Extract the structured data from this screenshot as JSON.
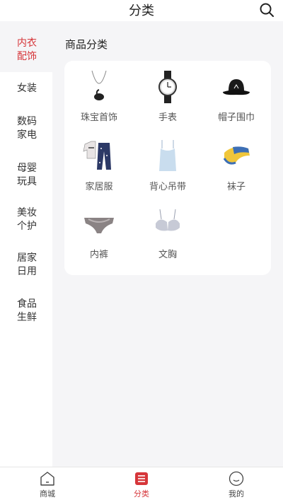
{
  "header": {
    "title": "分类",
    "search_icon": "search-icon"
  },
  "sidebar": {
    "items": [
      {
        "label": "内衣配饰",
        "active": true
      },
      {
        "label": "女装"
      },
      {
        "label": "数码家电"
      },
      {
        "label": "母婴玩具"
      },
      {
        "label": "美妆个护"
      },
      {
        "label": "居家日用"
      },
      {
        "label": "食品生鲜"
      }
    ]
  },
  "main": {
    "section_title": "商品分类",
    "categories": [
      {
        "label": "珠宝首饰",
        "icon": "necklace-icon"
      },
      {
        "label": "手表",
        "icon": "watch-icon"
      },
      {
        "label": "帽子围巾",
        "icon": "hat-icon"
      },
      {
        "label": "家居服",
        "icon": "pajamas-icon"
      },
      {
        "label": "背心吊带",
        "icon": "tank-top-icon"
      },
      {
        "label": "袜子",
        "icon": "socks-icon"
      },
      {
        "label": "内裤",
        "icon": "underwear-icon"
      },
      {
        "label": "文胸",
        "icon": "bra-icon"
      }
    ]
  },
  "tabbar": {
    "tabs": [
      {
        "label": "商城",
        "icon": "home-icon"
      },
      {
        "label": "分类",
        "icon": "category-icon",
        "active": true
      },
      {
        "label": "我的",
        "icon": "profile-icon"
      }
    ]
  },
  "colors": {
    "accent": "#d6363a",
    "background": "#f5f5f7"
  }
}
